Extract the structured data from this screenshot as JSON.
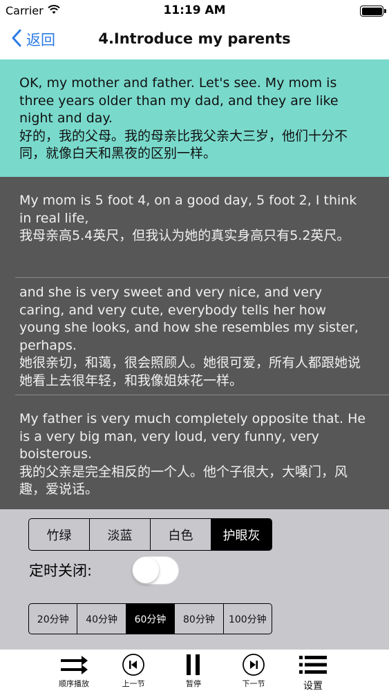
{
  "status_bar": {
    "carrier": "Carrier",
    "time": "11:19 AM"
  },
  "nav": {
    "back_label": "返回",
    "title": "4.Introduce my parents",
    "accent_color": "#2a7ae4"
  },
  "paragraphs": [
    {
      "text": "OK, my mother and father. Let's see. My mom is three years older than my dad, and they are like night and day.\n好的，我的父母。我的母亲比我父亲大三岁，他们十分不同，就像白天和黑夜的区别一样。",
      "active": true
    },
    {
      "text": "My mom is 5 foot 4, on a good day, 5 foot 2, I think in real life,\n我母亲高5.4英尺，但我认为她的真实身高只有5.2英尺。",
      "active": false
    },
    {
      "text": "and she is very sweet and very nice, and very caring, and very cute, everybody tells her how young she looks, and how she resembles my sister, perhaps.\n她很亲切，和蔼，很会照顾人。她很可爱，所有人都跟她说她看上去很年轻，和我像姐妹花一样。",
      "active": false
    },
    {
      "text": "My father is very much completely opposite that. He is a very big man, very loud, very funny, very boisterous.\n我的父亲是完全相反的一个人。他个子很大，大嗓门，风趣，爱说话。",
      "active": false
    }
  ],
  "colors": {
    "highlight": "#79dacc",
    "reading_bg": "#575757",
    "panel_bg": "#c8c7cc"
  },
  "theme_options": {
    "options": [
      "竹绿",
      "淡蓝",
      "白色",
      "护眼灰"
    ],
    "selected": "护眼灰"
  },
  "timer": {
    "label": "定时关闭:",
    "enabled": false,
    "options": [
      "20分钟",
      "40分钟",
      "60分钟",
      "80分钟",
      "100分钟"
    ],
    "selected": "60分钟"
  },
  "tabbar": {
    "items": [
      {
        "label": "顺序播放",
        "icon": "sequential-play-icon"
      },
      {
        "label": "上一节",
        "icon": "previous-section-icon"
      },
      {
        "label": "暂停",
        "icon": "pause-icon"
      },
      {
        "label": "下一节",
        "icon": "next-section-icon"
      },
      {
        "label": "设置",
        "icon": "settings-list-icon"
      }
    ]
  }
}
